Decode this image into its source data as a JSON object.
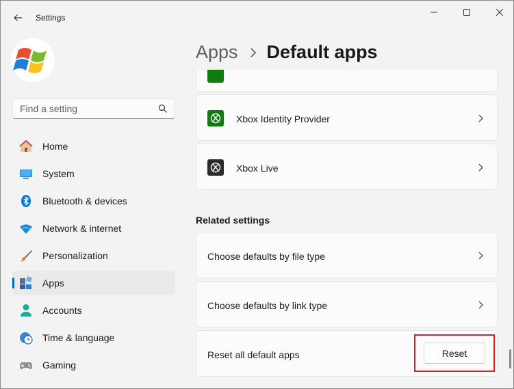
{
  "window": {
    "title": "Settings"
  },
  "search": {
    "placeholder": "Find a setting"
  },
  "sidebar": {
    "items": [
      {
        "label": "Home",
        "icon": "home-icon"
      },
      {
        "label": "System",
        "icon": "system-icon"
      },
      {
        "label": "Bluetooth & devices",
        "icon": "bluetooth-icon"
      },
      {
        "label": "Network & internet",
        "icon": "wifi-icon"
      },
      {
        "label": "Personalization",
        "icon": "brush-icon"
      },
      {
        "label": "Apps",
        "icon": "apps-icon",
        "active": true
      },
      {
        "label": "Accounts",
        "icon": "person-icon"
      },
      {
        "label": "Time & language",
        "icon": "clock-globe-icon"
      },
      {
        "label": "Gaming",
        "icon": "controller-icon"
      }
    ]
  },
  "header": {
    "parent": "Apps",
    "current": "Default apps"
  },
  "apps_list": [
    {
      "label": "Xbox Identity Provider",
      "icon": "xbox-icon",
      "color": "#107c10"
    },
    {
      "label": "Xbox Live",
      "icon": "xbox-icon",
      "color": "#2b2b2b"
    }
  ],
  "related": {
    "title": "Related settings",
    "items": [
      {
        "label": "Choose defaults by file type"
      },
      {
        "label": "Choose defaults by link type"
      }
    ],
    "reset": {
      "label": "Reset all default apps",
      "button": "Reset"
    }
  },
  "colors": {
    "accent": "#0067c0",
    "highlight": "#e02020",
    "xbox_green": "#107c10"
  }
}
